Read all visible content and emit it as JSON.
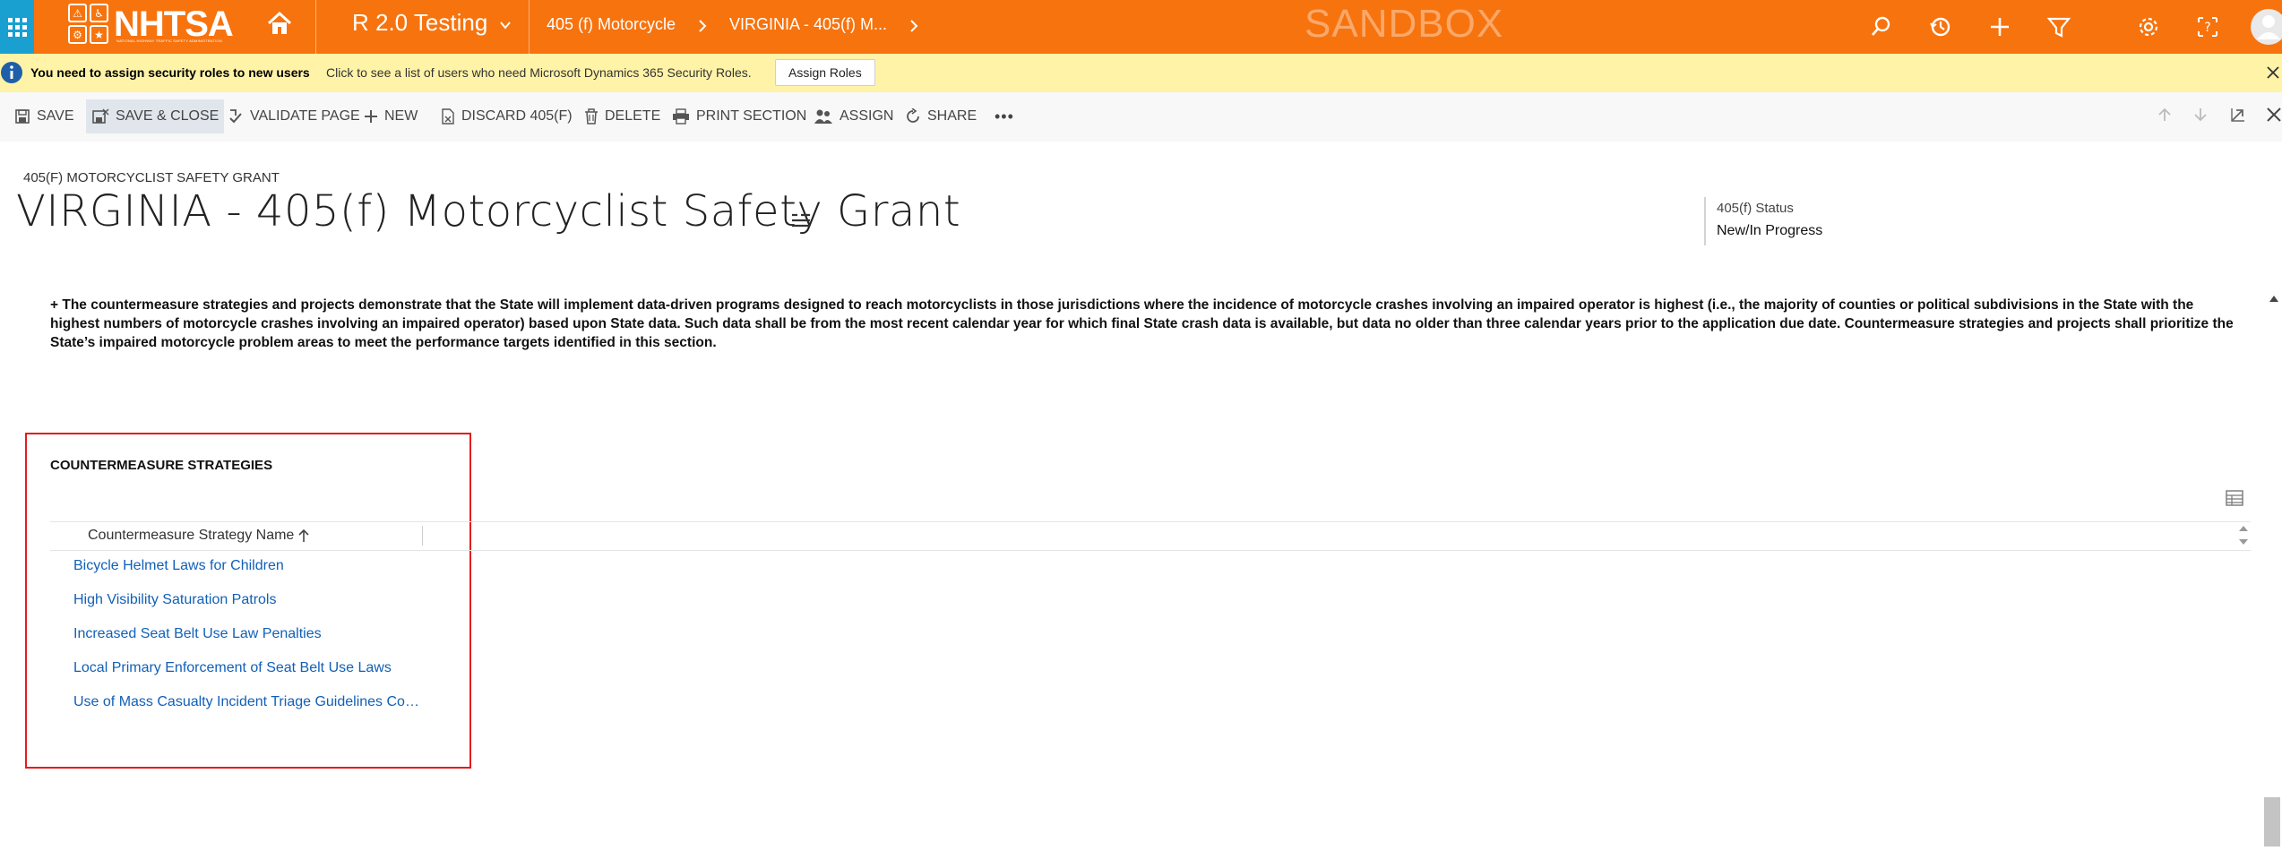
{
  "topbar": {
    "logo_text": "NHTSA",
    "logo_subtext": "NATIONAL HIGHWAY TRAFFIC SAFETY ADMINISTRATION",
    "app_name": "R 2.0 Testing",
    "breadcrumbs": [
      "405 (f) Motorcycle",
      "VIRGINIA - 405(f) M..."
    ],
    "environment_watermark": "SANDBOX",
    "icons": [
      "app-launcher-icon",
      "home-icon",
      "search-icon",
      "recent-history-icon",
      "new-record-icon",
      "advanced-find-filter-icon",
      "settings-gear-icon",
      "help-icon",
      "user-avatar-icon"
    ],
    "colors": {
      "bar": "#f7730e",
      "launcher": "#1a9fd1"
    }
  },
  "notification": {
    "title": "You need to assign security roles to new users",
    "message": "Click to see a list of users who need Microsoft Dynamics 365 Security Roles.",
    "button_label": "Assign Roles",
    "background": "#fff3a8"
  },
  "commandbar": {
    "save": "SAVE",
    "save_close": "SAVE & CLOSE",
    "validate": "VALIDATE PAGE",
    "new": "NEW",
    "discard": "DISCARD 405(F)",
    "delete": "DELETE",
    "print": "PRINT SECTION",
    "assign": "ASSIGN",
    "share": "SHARE",
    "more": "•••"
  },
  "header": {
    "entity_type": "405(F) MOTORCYCLIST SAFETY GRANT",
    "title": "VIRGINIA - 405(f) Motorcyclist Safety Grant",
    "status_label": "405(f) Status",
    "status_value": "New/In Progress"
  },
  "body": {
    "description": "+ The countermeasure strategies and projects demonstrate that the State will implement data-driven programs designed to reach motorcyclists in those jurisdictions where the incidence of motorcycle crashes involving an impaired operator is highest (i.e., the majority of counties or political subdivisions in the State with the highest numbers of motorcycle crashes involving an impaired operator) based upon State data. Such data shall be from the most recent calendar year for which final State crash data is available, but data no older than three calendar years prior to the application due date. Countermeasure strategies and projects shall prioritize the State’s impaired motorcycle problem areas to meet the performance targets identified in this section.",
    "section_title": "COUNTERMEASURE STRATEGIES",
    "grid": {
      "column_header": "Countermeasure Strategy Name",
      "sort": "ascending",
      "rows": [
        "Bicycle Helmet Laws for Children",
        "High Visibility Saturation Patrols",
        "Increased Seat Belt Use Law Penalties",
        "Local Primary Enforcement of Seat Belt Use Laws",
        "Use of Mass Casualty Incident Triage Guidelines Comp..."
      ]
    },
    "highlight_color": "#e41c1c"
  }
}
